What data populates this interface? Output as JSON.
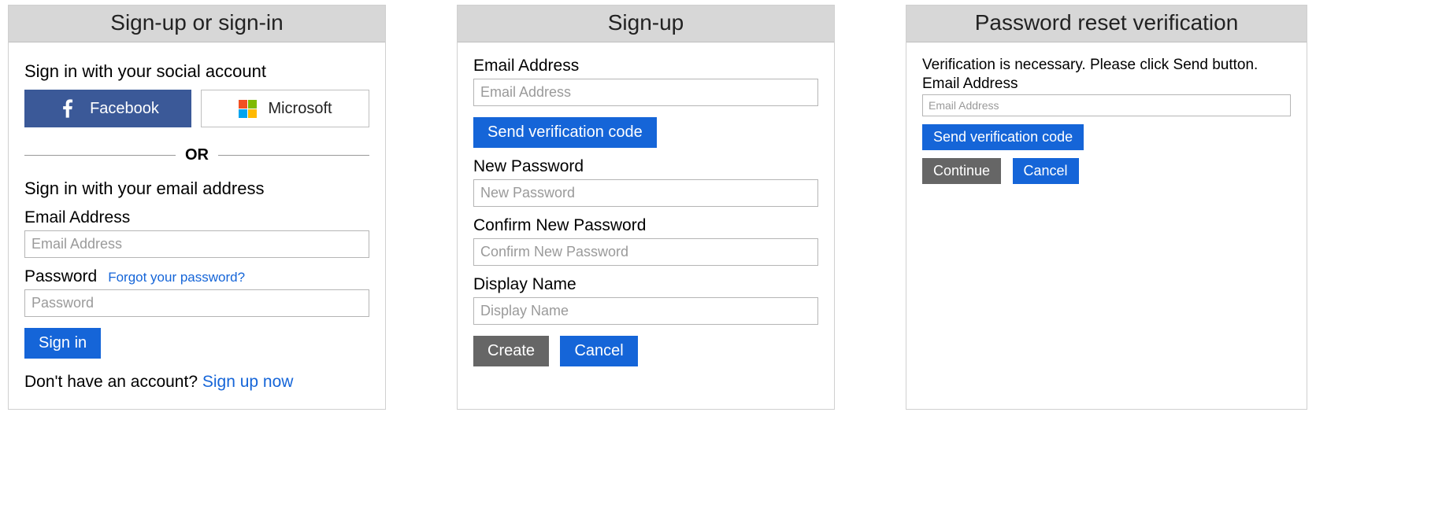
{
  "signin": {
    "header": "Sign-up or sign-in",
    "social_title": "Sign in with your social account",
    "facebook_label": "Facebook",
    "microsoft_label": "Microsoft",
    "divider": "OR",
    "email_section_title": "Sign in with your email address",
    "email_label": "Email Address",
    "email_placeholder": "Email Address",
    "password_label": "Password",
    "forgot_link": "Forgot your password?",
    "password_placeholder": "Password",
    "signin_button": "Sign in",
    "no_account_text": "Don't have an account? ",
    "signup_link": "Sign up now"
  },
  "signup": {
    "header": "Sign-up",
    "email_label": "Email Address",
    "email_placeholder": "Email Address",
    "send_code_button": "Send verification code",
    "new_pw_label": "New Password",
    "new_pw_placeholder": "New Password",
    "confirm_pw_label": "Confirm New Password",
    "confirm_pw_placeholder": "Confirm New Password",
    "display_name_label": "Display Name",
    "display_name_placeholder": "Display Name",
    "create_button": "Create",
    "cancel_button": "Cancel"
  },
  "reset": {
    "header": "Password reset verification",
    "instruction": "Verification is necessary. Please click Send button.",
    "email_label": "Email Address",
    "email_placeholder": "Email Address",
    "send_code_button": "Send verification code",
    "continue_button": "Continue",
    "cancel_button": "Cancel"
  }
}
